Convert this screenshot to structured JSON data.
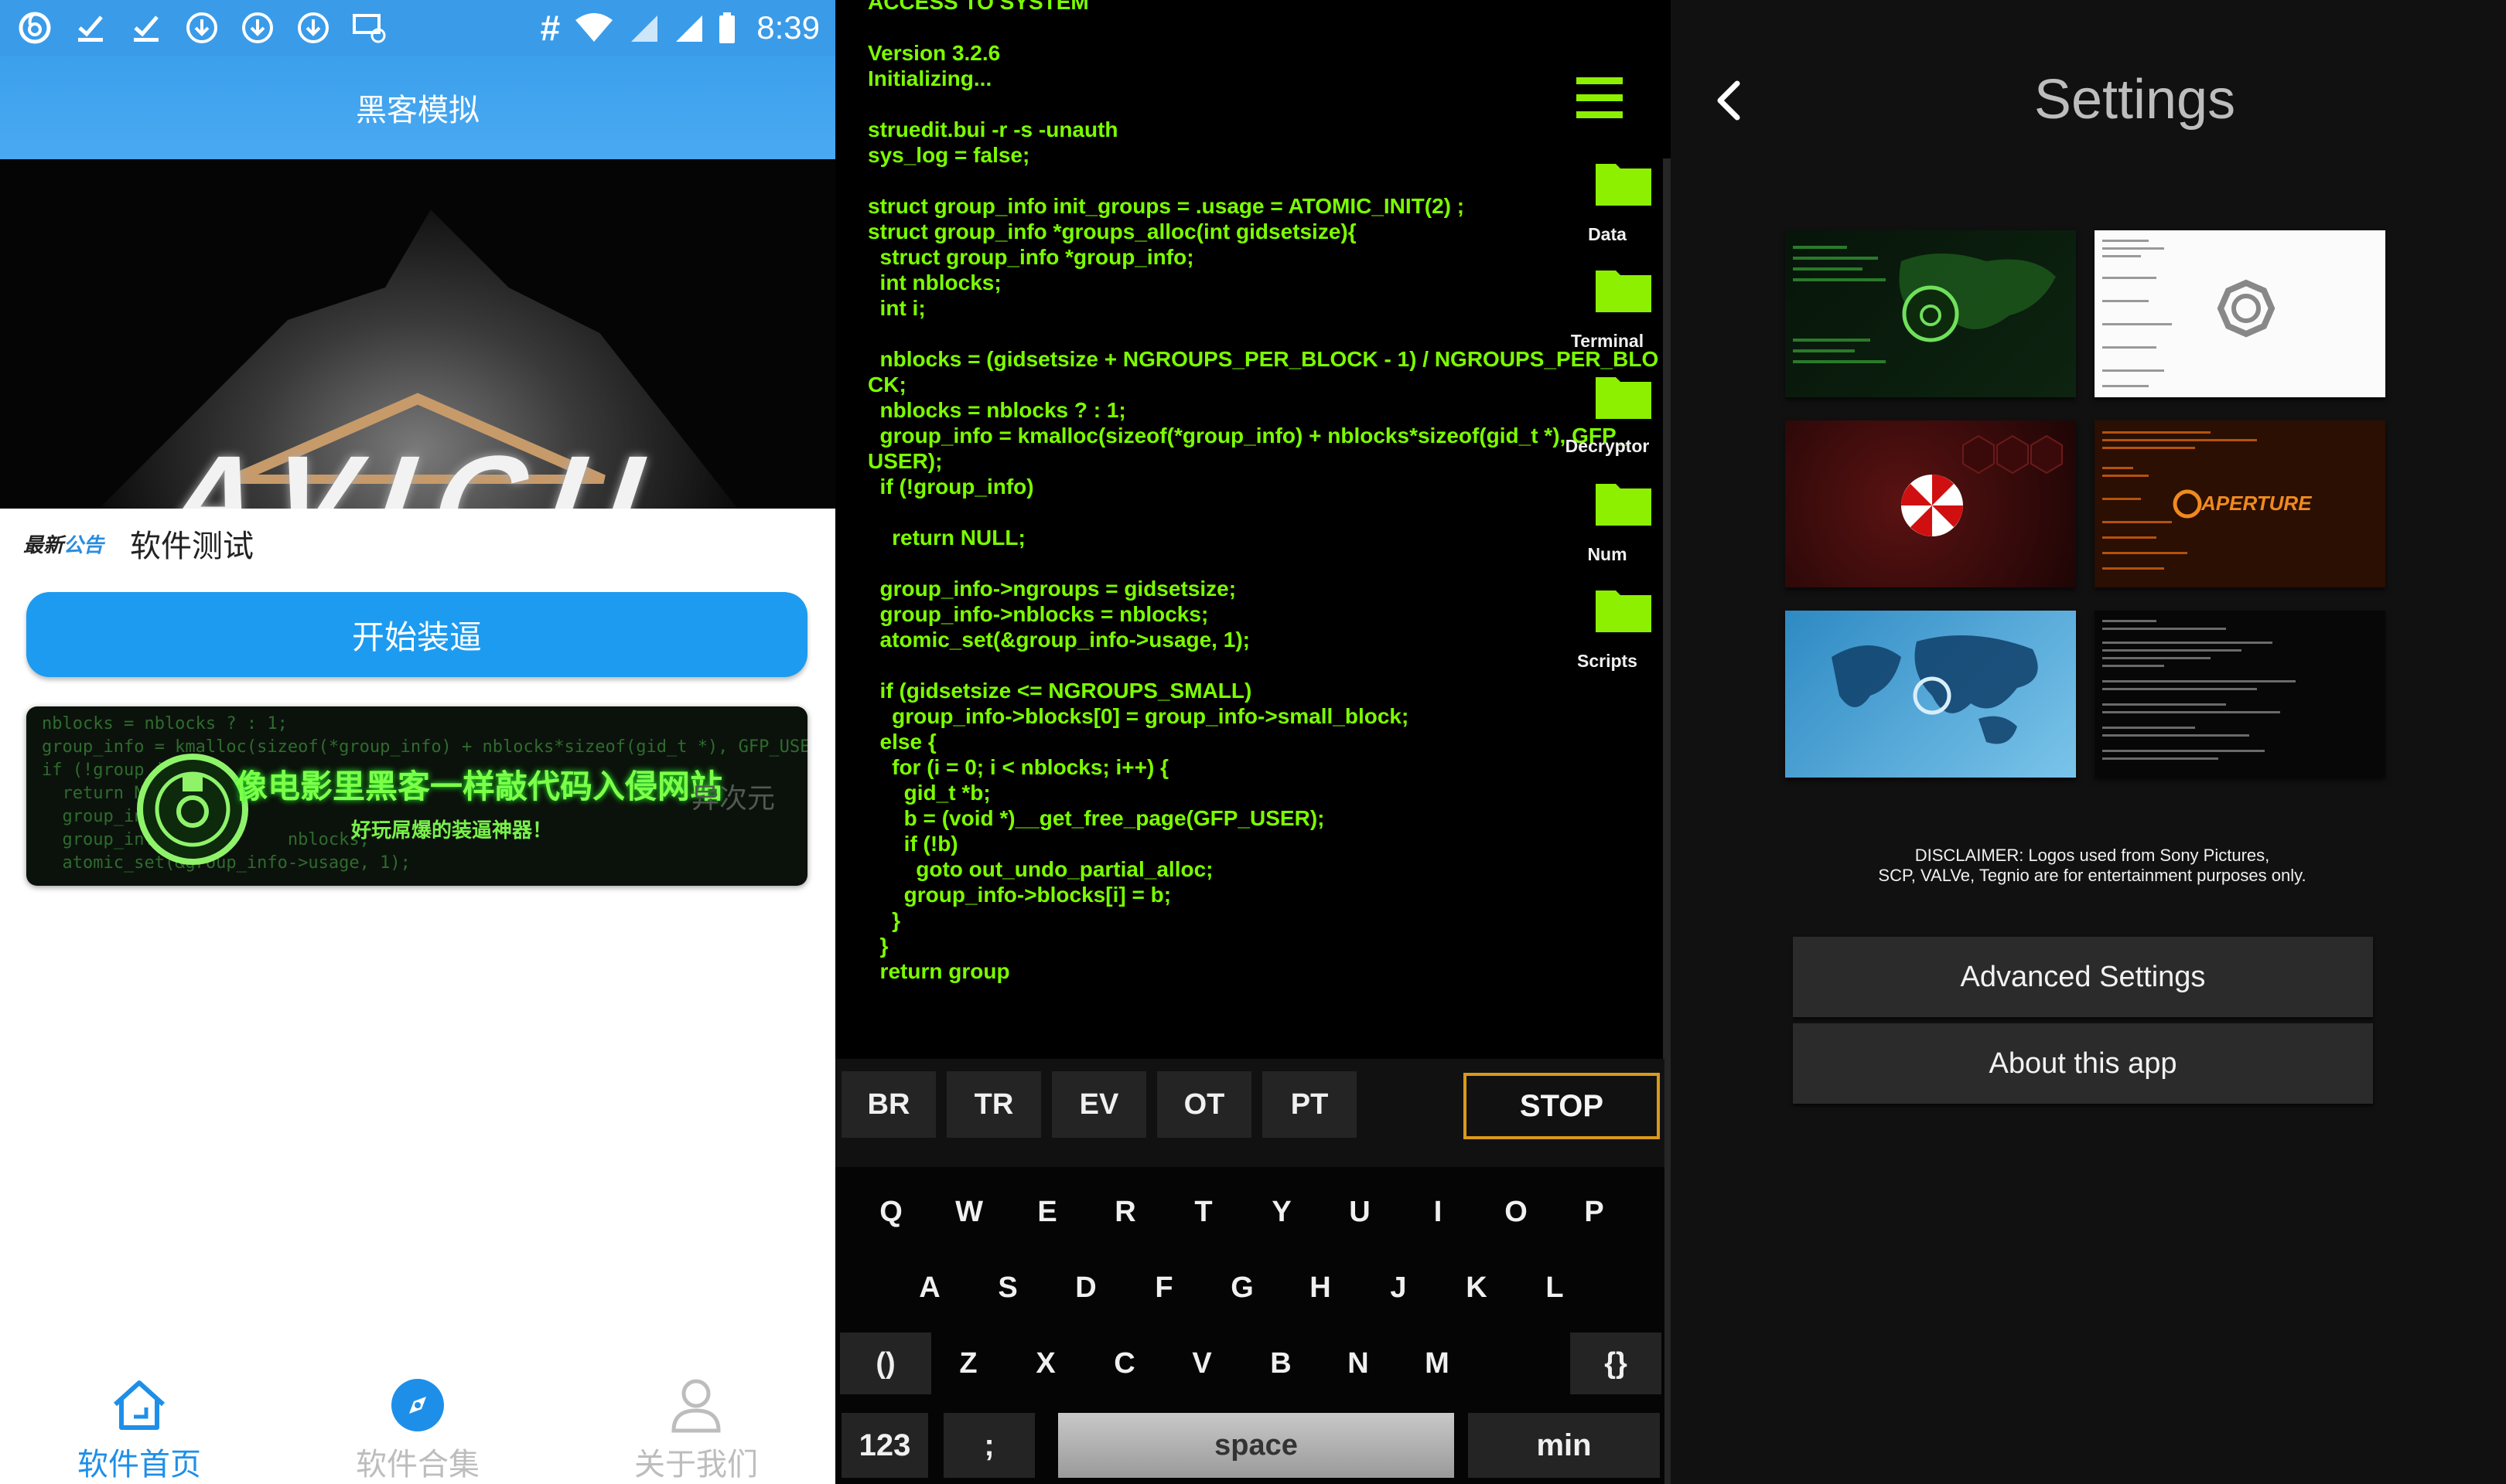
{
  "left_app": {
    "status_bar": {
      "time": "8:39",
      "hash_glyph": "#"
    },
    "title": "黑客模拟",
    "banner_logo_text": "AVICII",
    "notice": {
      "tag_part1": "最新",
      "tag_part2": "公告",
      "text": "软件测试"
    },
    "start_button": "开始装逼",
    "ad": {
      "title": "像电影里黑客一样敲代码入侵网站",
      "subtitle": "好玩屌爆的装逼神器！",
      "watermark": "异次元",
      "code_lines": [
        "nblocks = nblocks ? : 1;",
        "group_info = kmalloc(sizeof(*group_info) + nblocks*sizeof(gid_t *), GFP_USER);",
        "if (!group_info",
        "  return N",
        "  group_inf",
        "  group_inf             nblocks;",
        "  atomic_set(&group_info->usage, 1);"
      ]
    },
    "nav": [
      {
        "label": "软件首页",
        "icon": "home-icon",
        "active": true
      },
      {
        "label": "软件合集",
        "icon": "compass-icon",
        "active": false
      },
      {
        "label": "关于我们",
        "icon": "person-icon",
        "active": false
      }
    ],
    "colors": {
      "accent": "#1d9bf0",
      "status_bar": "#3a9be9"
    }
  },
  "terminal": {
    "code_lines": [
      "ACCESS TO SYSTEM",
      "",
      "Version 3.2.6",
      "Initializing...",
      "",
      "struedit.bui -r -s -unauth",
      "sys_log = false;",
      "",
      "struct group_info init_groups = .usage = ATOMIC_INIT(2) ;",
      "struct group_info *groups_alloc(int gidsetsize){",
      "  struct group_info *group_info;",
      "  int nblocks;",
      "  int i;",
      "",
      "  nblocks = (gidsetsize + NGROUPS_PER_BLOCK - 1) / NGROUPS_PER_BLO",
      "CK;",
      "  nblocks = nblocks ? : 1;",
      "  group_info = kmalloc(sizeof(*group_info) + nblocks*sizeof(gid_t *), GFP_",
      "USER);",
      "  if (!group_info)",
      "",
      "    return NULL;",
      "",
      "  group_info->ngroups = gidsetsize;",
      "  group_info->nblocks = nblocks;",
      "  atomic_set(&group_info->usage, 1);",
      "",
      "  if (gidsetsize <= NGROUPS_SMALL)",
      "    group_info->blocks[0] = group_info->small_block;",
      "  else {",
      "    for (i = 0; i < nblocks; i++) {",
      "      gid_t *b;",
      "      b = (void *)__get_free_page(GFP_USER);",
      "      if (!b)",
      "        goto out_undo_partial_alloc;",
      "      group_info->blocks[i] = b;",
      "    }",
      "  }",
      "  return group"
    ],
    "folders": [
      "Data",
      "Terminal",
      "Decryptor",
      "Num",
      "Scripts"
    ],
    "function_keys": [
      "BR",
      "TR",
      "EV",
      "OT",
      "PT"
    ],
    "stop_key": "STOP",
    "keyboard": {
      "row1": [
        "Q",
        "W",
        "E",
        "R",
        "T",
        "Y",
        "U",
        "I",
        "O",
        "P"
      ],
      "row2": [
        "A",
        "S",
        "D",
        "F",
        "G",
        "H",
        "J",
        "K",
        "L"
      ],
      "row3": [
        "()",
        "Z",
        "X",
        "C",
        "V",
        "B",
        "N",
        "M",
        "{}"
      ],
      "num": "123",
      "semicolon": ";",
      "space": "space",
      "min": "min"
    },
    "colors": {
      "code_text": "#7cfc00",
      "folder": "#8cf000",
      "stop_border": "#d99a1a"
    }
  },
  "settings": {
    "title": "Settings",
    "themes": [
      {
        "name": "green-world-map-theme",
        "emblem": "scp-icon"
      },
      {
        "name": "white-dharma-theme",
        "emblem": "dharma-icon"
      },
      {
        "name": "red-umbrella-theme",
        "emblem": "umbrella-icon"
      },
      {
        "name": "orange-aperture-theme",
        "emblem": "aperture-icon",
        "label": "APERTURE"
      },
      {
        "name": "blue-world-map-theme",
        "emblem": "globe-icon"
      },
      {
        "name": "dark-terminal-theme",
        "emblem": "none"
      }
    ],
    "disclaimer_line1": "DISCLAIMER: Logos used from Sony Pictures,",
    "disclaimer_line2": "SCP, VALVe, Tegnio are for entertainment purposes only.",
    "advanced_button": "Advanced Settings",
    "about_button": "About this app"
  }
}
